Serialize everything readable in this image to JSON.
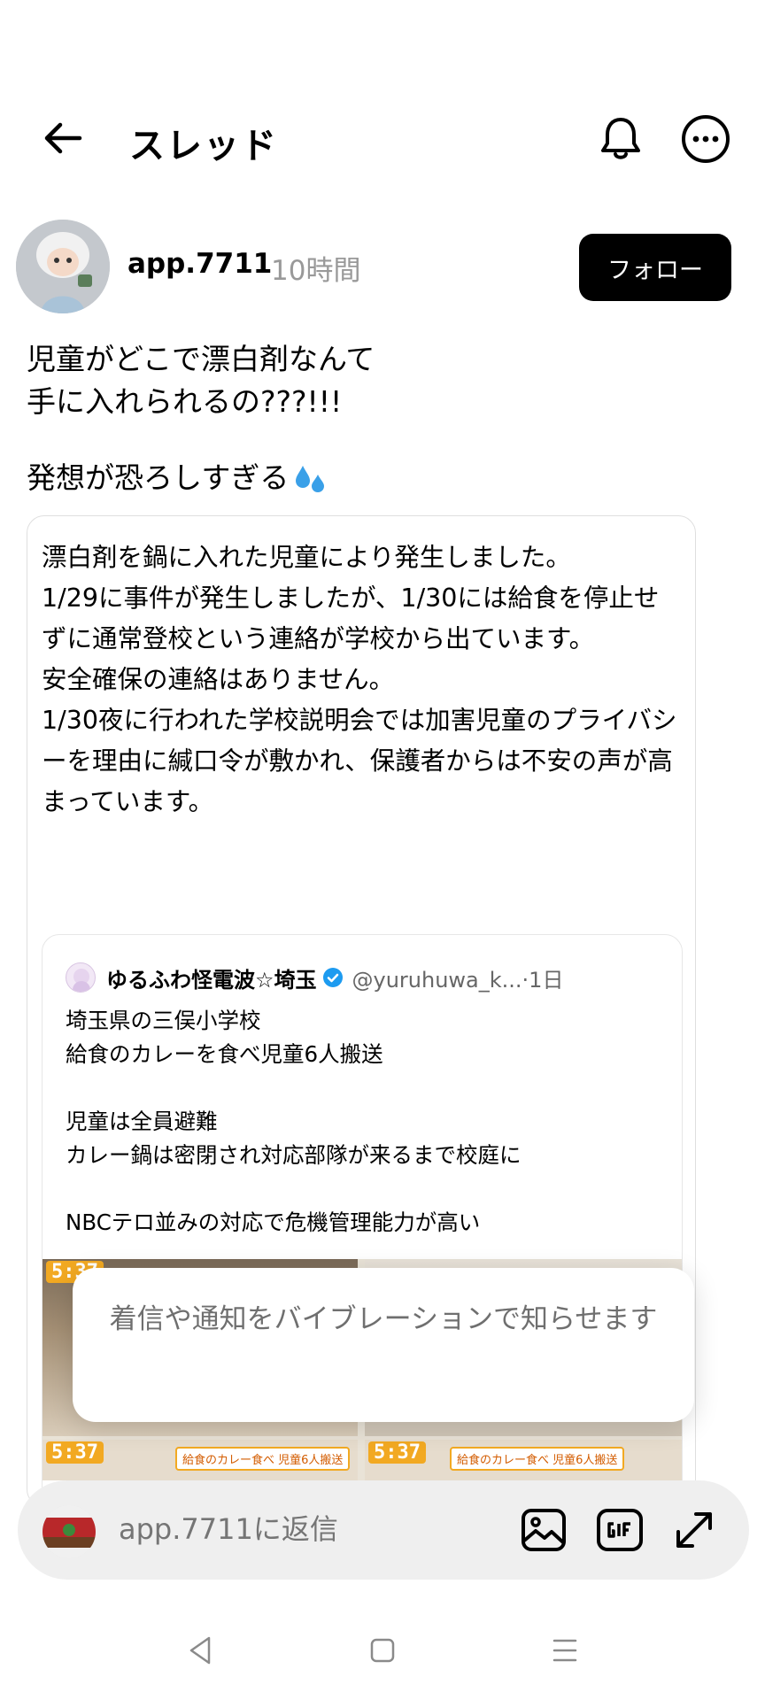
{
  "header": {
    "title": "スレッド"
  },
  "post": {
    "username": "app.7711",
    "time": "10時間",
    "follow_label": "フォロー",
    "text_line1": "児童がどこで漂白剤なんて",
    "text_line2": "手に入れられるの???!!!",
    "text_line3": "発想が恐ろしすぎる",
    "card_text": "漂白剤を鍋に入れた児童により発生しました。\n1/29に事件が発生しましたが、1/30には給食を停止せずに通常登校という連絡が学校から出ています。\n安全確保の連絡はありません。\n1/30夜に行われた学校説明会では加害児童のプライバシーを理由に緘口令が敷かれ、保護者からは不安の声が高まっています。"
  },
  "quote": {
    "name": "ゆるふわ怪電波☆埼玉",
    "handle": "@yuruhuwa_k...·1日",
    "body": "埼玉県の三俣小学校\n給食のカレーを食べ児童6人搬送\n\n児童は全員避難\nカレー鍋は密閉され対応部隊が来るまで校庭に\n\nNBCテロ並みの対応で危機管理能力が高い",
    "media": {
      "timestamp_1": "5:37",
      "timestamp_2": "5:37",
      "timestamp_3": "5:37",
      "caption_1": "給食のカレー食べ 児童6人搬送",
      "caption_2": "給食のカレー食べ 児童6人搬送"
    }
  },
  "toast": {
    "text": "着信や通知をバイブレーションで知らせます"
  },
  "reply": {
    "placeholder": "app.7711に返信"
  },
  "icons": {
    "back": "arrow-left-icon",
    "bell": "bell-icon",
    "more": "more-horizontal-icon",
    "image": "image-icon",
    "gif": "gif-icon",
    "expand": "expand-icon",
    "verified": "verified-badge-icon"
  },
  "colors": {
    "follow_bg": "#000000",
    "verified": "#1d9bf0",
    "sweat": "#3aa0e8",
    "news_badge": "#f2a922"
  }
}
